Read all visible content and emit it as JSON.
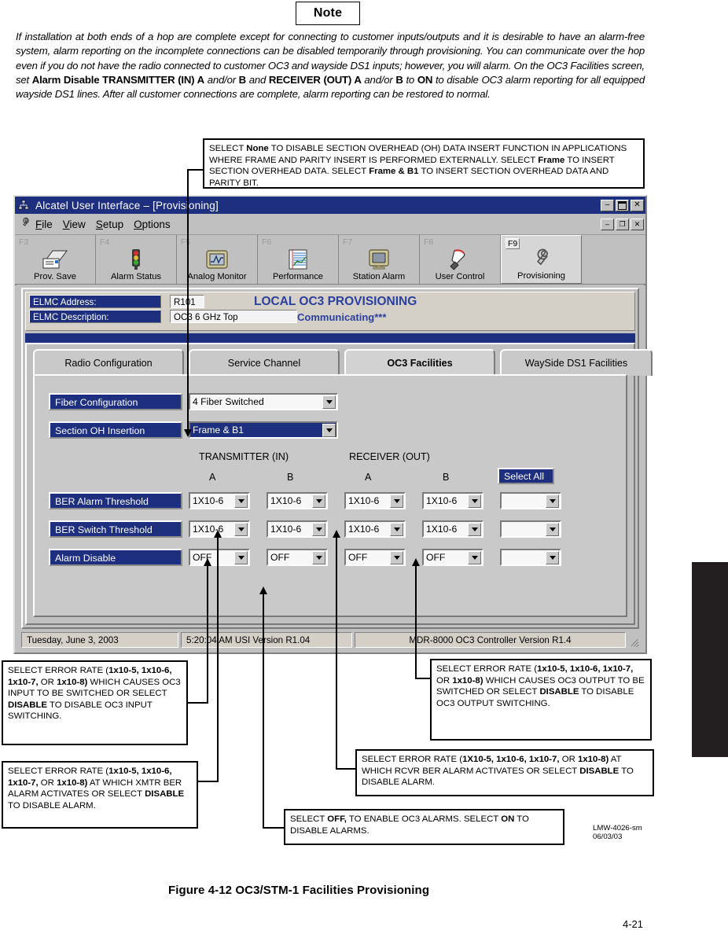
{
  "note": {
    "heading": "Note",
    "body_html": "<i>If installation at both ends of a hop are complete except for connecting to customer inputs/outputs and it is desirable to have an alarm-free system, alarm reporting on the incomplete connections can be disabled temporarily through provisioning. You can communicate over the hop even if you do not have the radio connected to customer OC3 and wayside DS1 inputs; however, you will alarm. On the OC3 Facilities screen, set </i><b>Alarm Disable TRANSMITTER (IN) A</b><i> and/or </i><b>B</b><i> and </i><b>RECEIVER (OUT) A</b><i> and/or </i><b>B</b><i> to </i><b>ON</b><i> to disable OC3 alarm reporting for all equipped wayside DS1 lines. After all customer connections are complete, alarm reporting can be restored to normal.</i>"
  },
  "callouts": {
    "section_oh": "SELECT <b>None</b> TO DISABLE SECTION OVERHEAD (OH) DATA INSERT FUNCTION IN APPLICATIONS WHERE FRAME AND PARITY INSERT IS PERFORMED EXTERNALLY. SELECT <b>Frame</b> TO INSERT SECTION OVERHEAD DATA. SELECT <b>Frame &amp; B1</b> TO INSERT SECTION OVERHEAD DATA AND PARITY BIT.",
    "ber_switch_in": "SELECT ERROR RATE (<b>1x10-5, 1x10-6, 1x10-7,</b> OR <b>1x10-8)</b> WHICH CAUSES OC3 INPUT TO BE SWITCHED OR SELECT <b>DISABLE</b> TO DISABLE OC3 INPUT SWITCHING.",
    "ber_alarm_in": "SELECT ERROR RATE (<b>1x10-5, 1x10-6, 1x10-7,</b> OR <b>1x10-8)</b> AT WHICH XMTR BER ALARM ACTIVATES OR SELECT <b>DISABLE</b> TO DISABLE ALARM.",
    "ber_switch_out": "SELECT ERROR RATE (<b>1x10-5, 1x10-6, 1x10-7,</b> OR <b>1x10-8)</b> WHICH CAUSES OC3 OUTPUT TO BE SWITCHED OR SELECT <b>DISABLE</b> TO DISABLE OC3 OUTPUT SWITCHING.",
    "ber_alarm_out": "SELECT ERROR RATE (<b>1X10-5, 1x10-6, 1x10-7,</b> OR <b>1x10-8)</b> AT WHICH RCVR BER ALARM ACTIVATES OR SELECT <b>DISABLE</b> TO DISABLE ALARM.",
    "alarm_disable": "SELECT <b>OFF,</b> TO ENABLE OC3 ALARMS. SELECT <b>ON</b> TO DISABLE ALARMS."
  },
  "window": {
    "title": "Alcatel User Interface – [Provisioning]",
    "icon": "app-icon",
    "title_buttons": [
      {
        "name": "minimize-button",
        "glyph": "–"
      },
      {
        "name": "maximize-button",
        "glyph": "■"
      },
      {
        "name": "close-button",
        "glyph": "✕"
      }
    ],
    "mdi_buttons": [
      {
        "name": "mdi-minimize-button",
        "glyph": "–"
      },
      {
        "name": "mdi-restore-button",
        "glyph": "❐"
      },
      {
        "name": "mdi-close-button",
        "glyph": "✕"
      }
    ]
  },
  "menu": {
    "icon": "wrench-icon",
    "items": [
      {
        "prefix": "F",
        "rest": "ile"
      },
      {
        "prefix": "V",
        "rest": "iew"
      },
      {
        "prefix": "S",
        "rest": "etup"
      },
      {
        "prefix": "O",
        "rest": "ptions"
      }
    ]
  },
  "toolbar": {
    "buttons": [
      {
        "fkey": "F3",
        "label": "Prov. Save",
        "icon": "prov-save-icon",
        "active": false
      },
      {
        "fkey": "F4",
        "label": "Alarm Status",
        "icon": "traffic-light-icon",
        "active": false
      },
      {
        "fkey": "F5",
        "label": "Analog Monitor",
        "icon": "waveform-icon",
        "active": false
      },
      {
        "fkey": "F6",
        "label": "Performance",
        "icon": "chart-lines-icon",
        "active": false
      },
      {
        "fkey": "F7",
        "label": "Station Alarm",
        "icon": "monitor-icon",
        "active": false
      },
      {
        "fkey": "F8",
        "label": "User Control",
        "icon": "hand-icon",
        "active": false
      },
      {
        "fkey": "F9",
        "label": "Provisioning",
        "icon": "wrench-icon",
        "active": true
      }
    ]
  },
  "header": {
    "elmc_address_label": "ELMC Address:",
    "elmc_address_value": "R101",
    "elmc_description_label": "ELMC Description:",
    "elmc_description_value": "OC3 6 GHz Top",
    "screen_title": "LOCAL OC3 PROVISIONING",
    "status": "Communicating***"
  },
  "tabs": [
    {
      "label": "Radio Configuration",
      "selected": false
    },
    {
      "label": "Service Channel",
      "selected": false
    },
    {
      "label": "OC3 Facilities",
      "selected": true
    },
    {
      "label": "WaySide DS1 Facilities",
      "selected": false
    }
  ],
  "form": {
    "fiber_configuration": {
      "label": "Fiber Configuration",
      "value": "4 Fiber Switched",
      "highlighted": false
    },
    "section_oh_insertion": {
      "label": "Section OH Insertion",
      "value": "Frame & B1",
      "highlighted": true
    },
    "group_headers": [
      "TRANSMITTER (IN)",
      "RECEIVER (OUT)"
    ],
    "column_headers": [
      "A",
      "B",
      "A",
      "B"
    ],
    "select_all_label": "Select All",
    "rows": [
      {
        "label": "BER Alarm Threshold",
        "values": [
          "1X10-6",
          "1X10-6",
          "1X10-6",
          "1X10-6"
        ],
        "select_all": ""
      },
      {
        "label": "BER Switch Threshold",
        "values": [
          "1X10-6",
          "1X10-6",
          "1X10-6",
          "1X10-6"
        ],
        "select_all": ""
      },
      {
        "label": "Alarm Disable",
        "values": [
          "OFF",
          "OFF",
          "OFF",
          "OFF"
        ],
        "select_all": ""
      }
    ]
  },
  "statusbar": {
    "date": "Tuesday, June 3, 2003",
    "time_version": "5:20:04 AM    USI Version R1.04",
    "product": "MDR-8000 OC3          Controller Version R1.4"
  },
  "figure": {
    "caption": "Figure 4-12   OC3/STM-1 Facilities Provisioning",
    "page_number": "4-21",
    "doc_id": "LMW-4026-sm",
    "doc_date": "06/03/03"
  }
}
